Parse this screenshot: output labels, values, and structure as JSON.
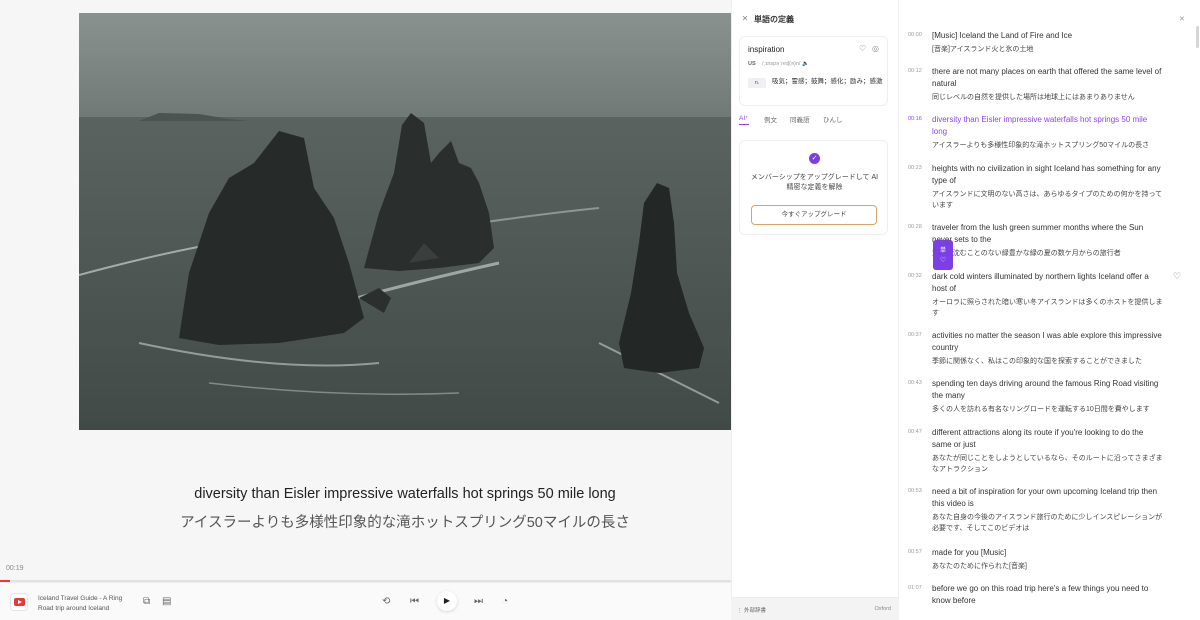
{
  "player": {
    "subtitle_en": "diversity than Eisler impressive waterfalls hot springs 50 mile long",
    "subtitle_ja": "アイスラーよりも多様性印象的な滝ホットスプリング50マイルの長さ",
    "current_time": "00:19",
    "progress_fraction": 0.014,
    "track_title": "Iceland Travel Guide - A Ring Road trip around Iceland",
    "controls": {
      "loop_icon": "⟲",
      "prev_icon": "⏮",
      "play_icon": "▶",
      "next_icon": "⏭",
      "speed_icon": "◔",
      "pip_icon": "⧉",
      "queue_icon": "▤"
    }
  },
  "dictionary": {
    "title": "単語の定義",
    "close_icon": "✕",
    "word": "inspiration",
    "heart_icon": "♡",
    "check_icon": "◎",
    "region": "US",
    "pronunciation": "/ˌɪnspəˈreɪʃ(ə)n/ 🔈",
    "part_of_speech": "n.",
    "definition": "吸気；霊感；鼓舞；感化；励み；感激",
    "tabs": [
      "AI⁺",
      "例文",
      "同義語",
      "ひんし"
    ],
    "active_tab": 0,
    "badge_icon": "✓",
    "upgrade_text": "メンバーシップをアップグレードして AI 精密な定義を解除",
    "upgrade_button": "今すぐアップグレード",
    "footer_left": "⋮ 外部辞書",
    "footer_right": "Oxford"
  },
  "transcript": {
    "close_icon": "✕",
    "popup": {
      "line1": "単",
      "line2": "♡"
    },
    "row_heart_icon": "♡",
    "items": [
      {
        "time": "00:00",
        "en": "[Music] Iceland the Land of Fire and Ice",
        "ja": "[音楽]アイスランド火と氷の土地"
      },
      {
        "time": "00:12",
        "en": "there are not many places on earth that offered the same level of natural",
        "ja": "同じレベルの自然を提供した場所は地球上にはあまりありません"
      },
      {
        "time": "00:16",
        "en": "diversity than Eisler impressive waterfalls hot springs 50 mile long",
        "ja": "アイスラーよりも多様性印象的な滝ホットスプリング50マイルの長さ",
        "active": true
      },
      {
        "time": "00:23",
        "en": "heights with no civilization in sight Iceland has something for any type of",
        "ja": "アイスランドに文明のない高さは、あらゆるタイプのための何かを持っています"
      },
      {
        "time": "00:28",
        "en": "traveler from the lush green summer months where the Sun never sets to the",
        "ja": "決して沈むことのない緑豊かな緑の夏の数ケ月からの旅行者"
      },
      {
        "time": "00:32",
        "en": "dark cold winters illuminated by northern lights Iceland offer a host of",
        "ja": "オーロラに照らされた暗い寒い冬アイスランドは多くのホストを提供します"
      },
      {
        "time": "00:37",
        "en": "activities no matter the season I was able explore this impressive country",
        "ja": "季節に関係なく、私はこの印象的な国を探索することができました"
      },
      {
        "time": "00:43",
        "en": "spending ten days driving around the famous Ring Road visiting the many",
        "ja": "多くの人を訪れる有名なリングロードを運転する10日間を費やします"
      },
      {
        "time": "00:47",
        "en": "different attractions along its route if you're looking to do the same or just",
        "ja": "あなたが同じことをしようとしているなら、そのルートに沿ってさまざまなアトラクション"
      },
      {
        "time": "00:53",
        "en": "need a bit of inspiration for your own upcoming Iceland trip then this video is",
        "ja": "あなた自身の今後のアイスランド旅行のために少しインスピレーションが必要です、そしてこのビデオは"
      },
      {
        "time": "00:57",
        "en": "made for you [Music]",
        "ja": "あなたのために作られた[音楽]"
      },
      {
        "time": "01:07",
        "en": "before we go on this road trip here's a few things you need to know before",
        "ja": ""
      }
    ]
  }
}
